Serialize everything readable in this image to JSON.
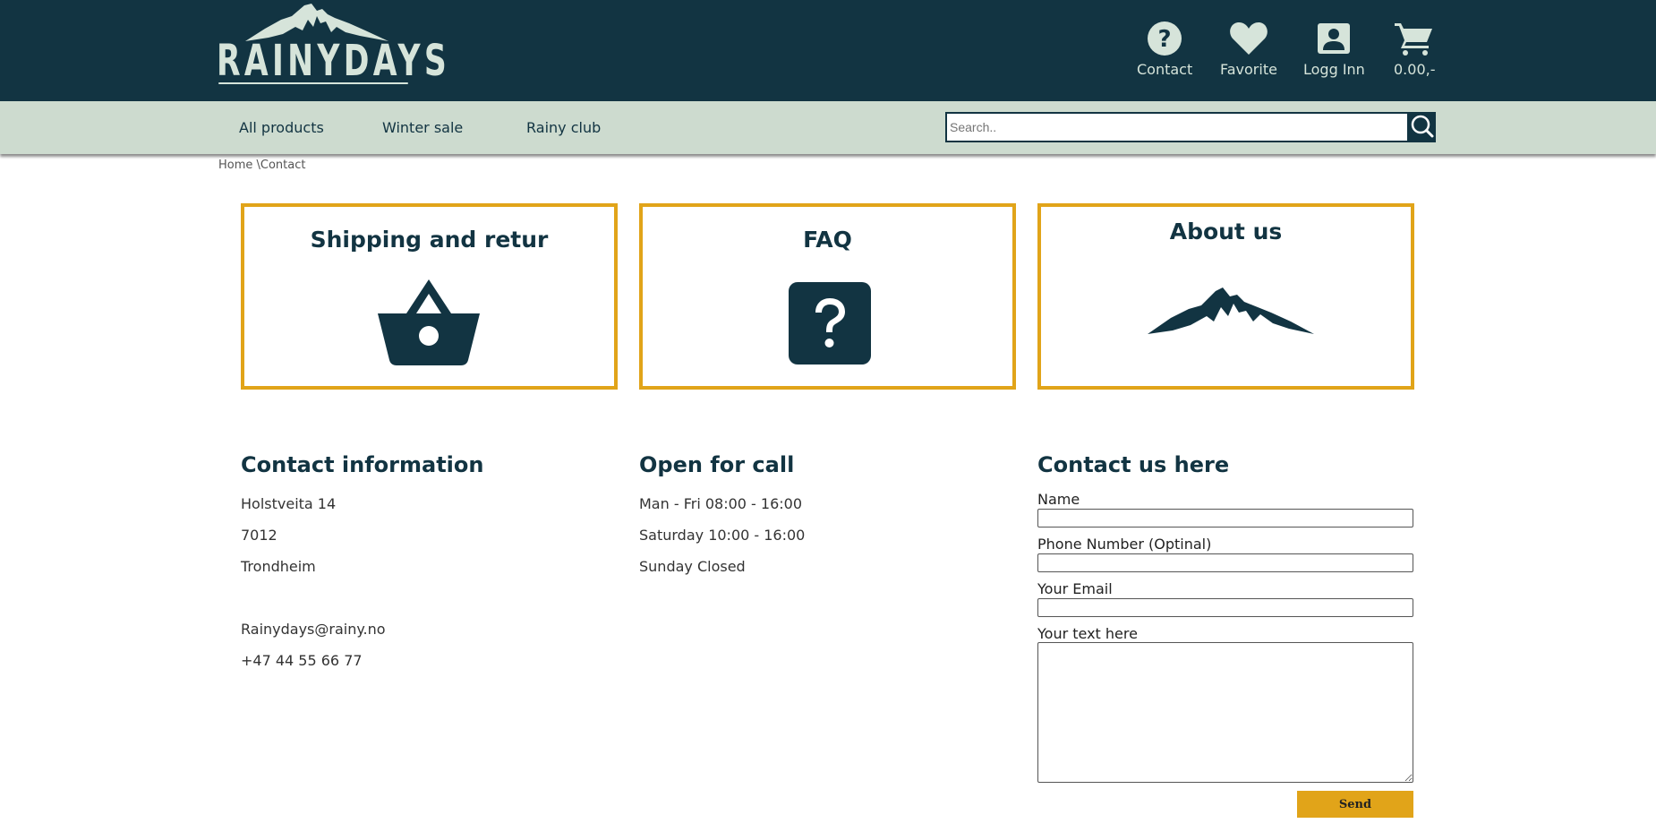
{
  "brand": {
    "name": "RAINYDAYS"
  },
  "header": {
    "items": [
      {
        "label": "Contact",
        "icon": "question-circle-icon"
      },
      {
        "label": "Favorite",
        "icon": "heart-icon"
      },
      {
        "label": "Logg Inn",
        "icon": "account-box-icon"
      },
      {
        "label": "0.00,-",
        "icon": "cart-icon"
      }
    ]
  },
  "nav": {
    "links": [
      "All products",
      "Winter sale",
      "Rainy club"
    ],
    "search": {
      "placeholder": "Search..",
      "value": ""
    }
  },
  "breadcrumb": {
    "home": "Home",
    "separator": " \\",
    "current": "Contact"
  },
  "cards": [
    {
      "title": "Shipping and retur",
      "icon": "shopping-basket-icon"
    },
    {
      "title": "FAQ",
      "icon": "question-square-icon"
    },
    {
      "title": "About us",
      "icon": "mountain-icon"
    }
  ],
  "contact_info": {
    "title": "Contact information",
    "address": [
      "Holstveita 14",
      "7012",
      "Trondheim"
    ],
    "email": "Rainydays@rainy.no",
    "phone": "+47 44 55 66 77"
  },
  "hours": {
    "title": "Open for call",
    "lines": [
      "Man - Fri 08:00 - 16:00",
      "Saturday 10:00 - 16:00",
      "Sunday Closed"
    ]
  },
  "form": {
    "title": "Contact us here",
    "name_label": "Name",
    "phone_label": "Phone Number (Optinal)",
    "email_label": "Your Email",
    "text_label": "Your text here",
    "send_label": "Send"
  },
  "colors": {
    "header_bg": "#123442",
    "nav_bg": "#cddbcf",
    "accent": "#e1a419",
    "text_light": "#d6e4da"
  }
}
